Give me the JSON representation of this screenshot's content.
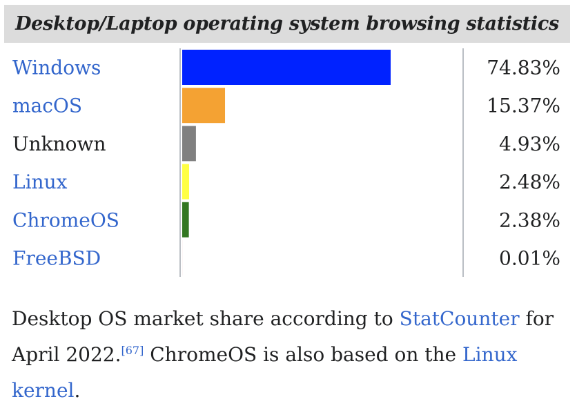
{
  "chart_data": {
    "type": "bar",
    "orientation": "horizontal",
    "title": "Desktop/Laptop operating system browsing statistics",
    "categories": [
      "Windows",
      "macOS",
      "Unknown",
      "Linux",
      "ChromeOS",
      "FreeBSD"
    ],
    "values": [
      74.83,
      15.37,
      4.93,
      2.48,
      2.38,
      0.01
    ],
    "value_labels": [
      "74.83%",
      "15.37%",
      "4.93%",
      "2.48%",
      "2.38%",
      "0.01%"
    ],
    "category_is_link": [
      true,
      true,
      false,
      true,
      true,
      true
    ],
    "colors": [
      "#0022ff",
      "#f4a233",
      "#808080",
      "#ffff44",
      "#337722",
      "#cc0000"
    ],
    "xlim": [
      0,
      74.83
    ],
    "grid": false,
    "legend": "none"
  },
  "colors": {
    "link": "#3366cc",
    "text": "#202122",
    "title_background": "#dcdcdc",
    "divider": "#a2a9b1"
  },
  "caption": {
    "text_before": "Desktop OS market share according to ",
    "link_statcounter": "StatCounter",
    "text_mid": " for April 2022.",
    "ref": "[67]",
    "text_after": " ChromeOS is also based on the ",
    "link_linux_kernel": "Linux kernel",
    "text_end": "."
  }
}
